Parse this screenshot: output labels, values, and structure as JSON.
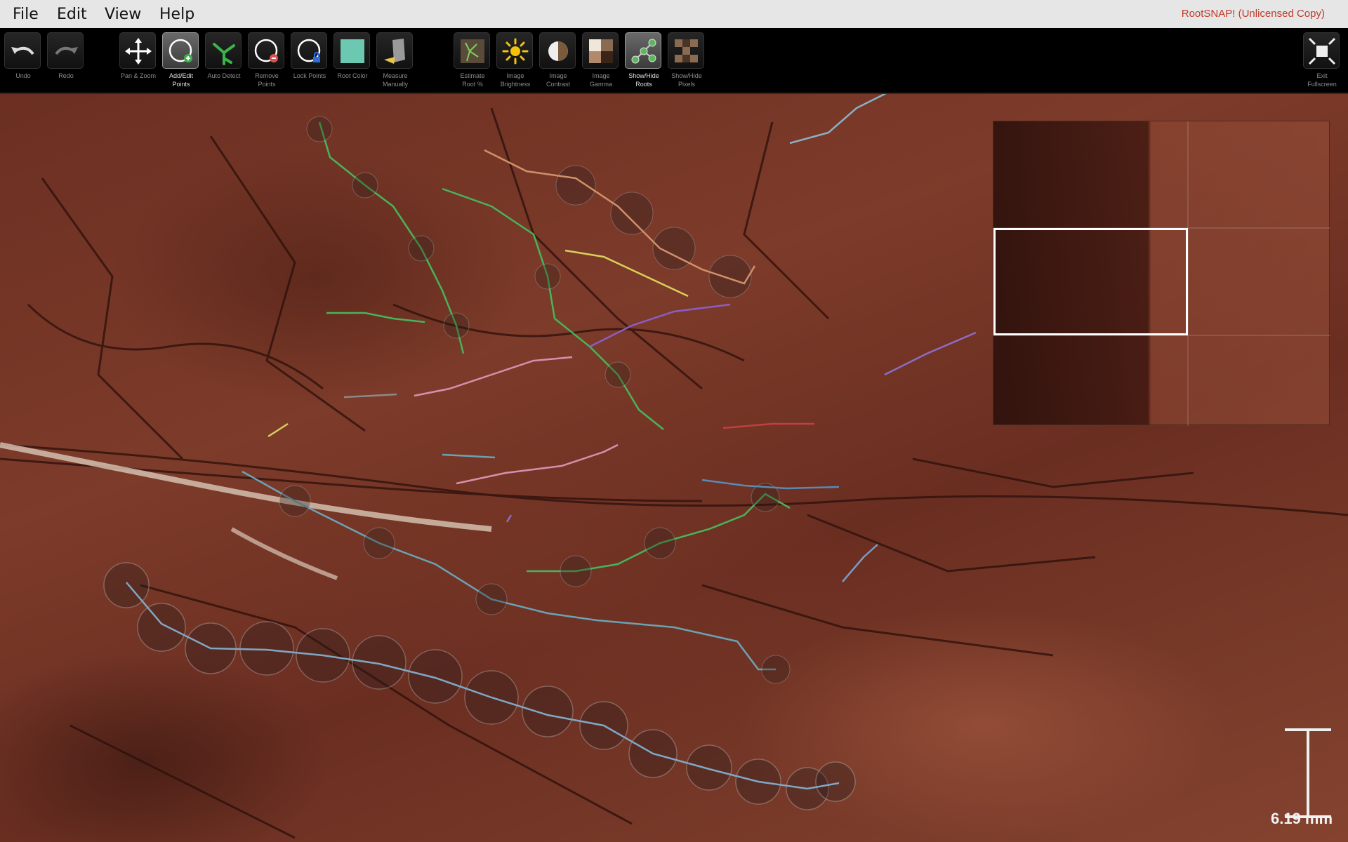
{
  "menu": {
    "file": "File",
    "edit": "Edit",
    "view": "View",
    "help": "Help"
  },
  "app_title": "RootSNAP!  (Unlicensed Copy)",
  "toolbar": {
    "undo": "Undo",
    "redo": "Redo",
    "pan_zoom": "Pan & Zoom",
    "add_edit_points": "Add/Edit\nPoints",
    "auto_detect": "Auto Detect",
    "remove_points": "Remove\nPoints",
    "lock_points": "Lock Points",
    "root_color": "Root Color",
    "measure_manually": "Measure\nManually",
    "estimate_root": "Estimate\nRoot %",
    "image_brightness": "Image\nBrightness",
    "image_contrast": "Image\nContrast",
    "image_gamma": "Image\nGamma",
    "show_hide_roots": "Show/Hide\nRoots",
    "show_hide_pixels": "Show/Hide\nPixels",
    "exit_fullscreen": "Exit\nFullscreen"
  },
  "active_tools": [
    "add-edit-points",
    "show-hide-roots"
  ],
  "colors": {
    "root_color_swatch": "#6cc8b0",
    "title_red": "#c0392b"
  },
  "scale": {
    "label": "6.19 mm"
  }
}
